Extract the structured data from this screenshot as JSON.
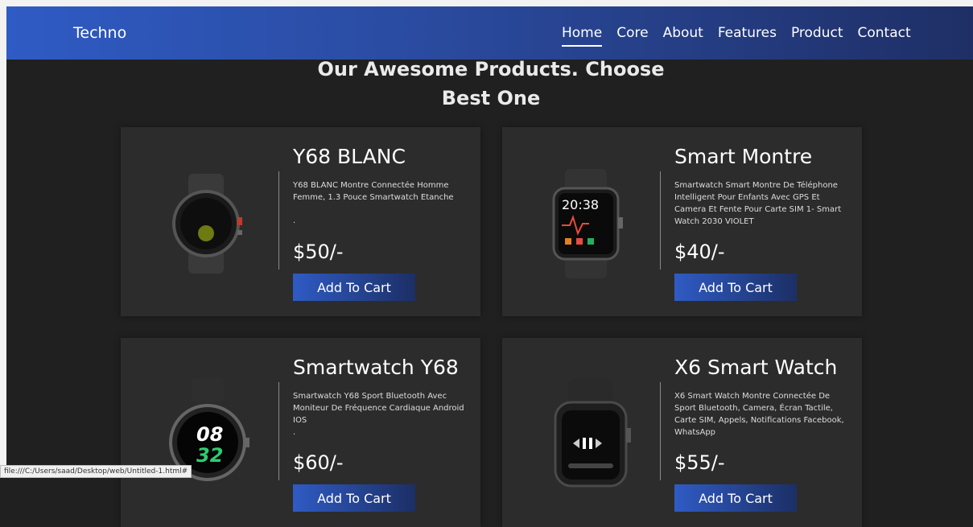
{
  "navbar": {
    "brand": "Techno",
    "links": [
      {
        "label": "Home"
      },
      {
        "label": "Core"
      },
      {
        "label": "About"
      },
      {
        "label": "Features"
      },
      {
        "label": "Product"
      },
      {
        "label": "Contact"
      }
    ]
  },
  "heading": {
    "line1": "Our Awesome Products. Choose",
    "line2": "Best One"
  },
  "products": [
    {
      "title": "Y68 BLANC",
      "desc": "Y68 BLANC Montre Connectée Homme Femme, 1.3 Pouce Smartwatch Etanche",
      "desc_extra": ".",
      "price": "$50/-",
      "button": "Add To Cart",
      "icon": "sport-watch-icon"
    },
    {
      "title": "Smart Montre",
      "desc": "Smartwatch Smart Montre De Téléphone Intelligent Pour Enfants Avec GPS Et Camera Et Fente Pour Carte SIM 1- Smart Watch 2030 VIOLET",
      "price": "$40/-",
      "button": "Add To Cart",
      "icon": "square-smartwatch-icon",
      "watch_time": "20:38"
    },
    {
      "title": "Smartwatch Y68",
      "desc": "Smartwatch Y68 Sport Bluetooth Avec Moniteur De Fréquence Cardiaque Android IOS",
      "desc_extra": ".",
      "price": "$60/-",
      "button": "Add To Cart",
      "icon": "round-smartwatch-icon",
      "watch_h": "08",
      "watch_m": "32"
    },
    {
      "title": "X6 Smart Watch",
      "desc": "X6 Smart Watch Montre Connectée De Sport Bluetooth, Camera, Écran Tactile, Carte SIM, Appels, Notifications Facebook, WhatsApp",
      "price": "$55/-",
      "button": "Add To Cart",
      "icon": "apple-style-watch-icon"
    }
  ],
  "statusbar": {
    "url": "file:///C:/Users/saad/Desktop/web/Untitled-1.html#"
  },
  "colors": {
    "nav_gradient_start": "#2f5bc4",
    "nav_gradient_end": "#1f2f66",
    "page_bg": "#202020",
    "card_bg": "#2c2c2c"
  }
}
